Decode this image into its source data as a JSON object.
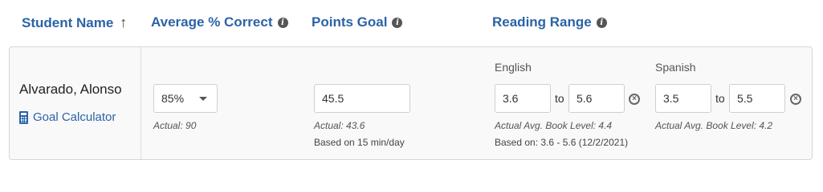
{
  "headers": {
    "student_name": "Student Name",
    "sort_arrow": "↑",
    "average_correct": "Average % Correct",
    "points_goal": "Points Goal",
    "reading_range": "Reading Range"
  },
  "icons": {
    "info": "info-icon",
    "sort": "arrow-up-icon",
    "calculator": "calculator-icon",
    "clear": "clear-circle-icon"
  },
  "colors": {
    "header_blue": "#2b63a6",
    "link_blue": "#2b63a6"
  },
  "student": {
    "name": "Alvarado, Alonso",
    "goal_calculator": "Goal Calculator",
    "average_correct": {
      "selected": "85%",
      "actual": "Actual: 90"
    },
    "points_goal": {
      "value": "45.5",
      "actual": "Actual: 43.6",
      "based_on": "Based on 15 min/day"
    },
    "reading_range": {
      "english": {
        "label": "English",
        "from": "3.6",
        "to_label": "to",
        "to": "5.6",
        "avg_level": "Actual Avg. Book Level: 4.4",
        "based_on": "Based on: 3.6 - 5.6 (12/2/2021)"
      },
      "spanish": {
        "label": "Spanish",
        "from": "3.5",
        "to_label": "to",
        "to": "5.5",
        "avg_level": "Actual Avg. Book Level: 4.2"
      }
    }
  }
}
